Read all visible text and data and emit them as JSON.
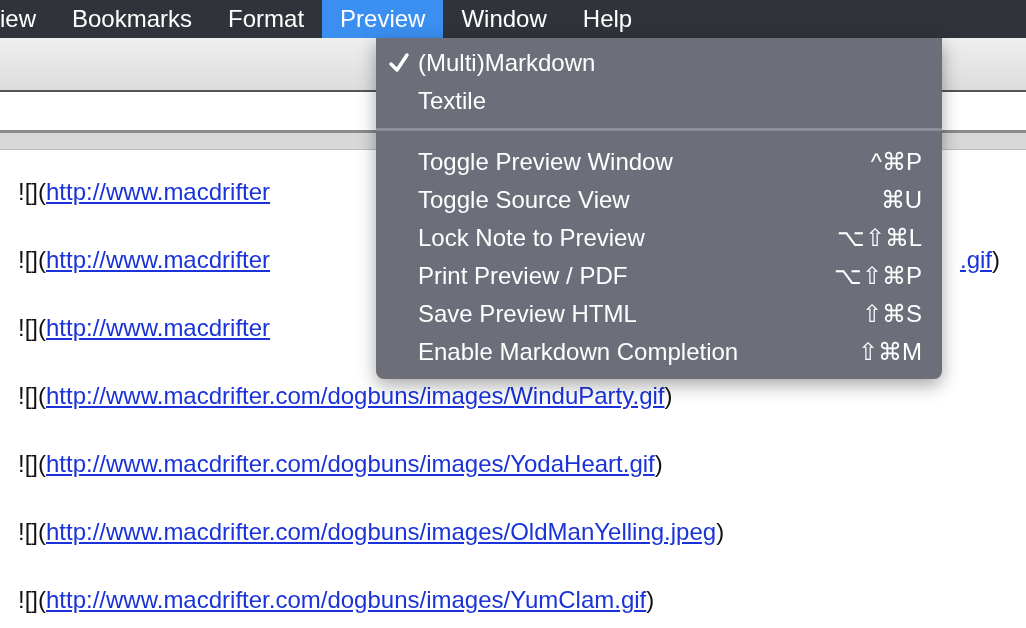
{
  "menubar": [
    {
      "label": "iew",
      "selected": false
    },
    {
      "label": "Bookmarks",
      "selected": false
    },
    {
      "label": "Format",
      "selected": false
    },
    {
      "label": "Preview",
      "selected": true
    },
    {
      "label": "Window",
      "selected": false
    },
    {
      "label": "Help",
      "selected": false
    }
  ],
  "menu": {
    "items": [
      {
        "kind": "option",
        "label": "(Multi)Markdown",
        "checked": true
      },
      {
        "kind": "option",
        "label": "Textile",
        "checked": false
      },
      {
        "kind": "separator"
      },
      {
        "kind": "command",
        "label": "Toggle Preview Window",
        "shortcut": "^⌘P"
      },
      {
        "kind": "command",
        "label": "Toggle Source View",
        "shortcut": "⌘U"
      },
      {
        "kind": "command",
        "label": "Lock Note to Preview",
        "shortcut": "⌥⇧⌘L"
      },
      {
        "kind": "command",
        "label": "Print Preview / PDF",
        "shortcut": "⌥⇧⌘P"
      },
      {
        "kind": "command",
        "label": "Save Preview HTML",
        "shortcut": "⇧⌘S"
      },
      {
        "kind": "command",
        "label": "Enable Markdown Completion",
        "shortcut": "⇧⌘M"
      }
    ]
  },
  "lines": [
    {
      "prefix": "![](",
      "link": "http://www.macdrifter"
    },
    {
      "prefix": "![](",
      "link": "http://www.macdrifter",
      "tail_link": ".gif",
      "tail": ")"
    },
    {
      "prefix": "![](",
      "link": "http://www.macdrifter"
    },
    {
      "prefix": "![](",
      "link": "http://www.macdrifter.com/dogbuns/images/WinduParty.gif",
      "tail": ")"
    },
    {
      "prefix": "![](",
      "link": "http://www.macdrifter.com/dogbuns/images/YodaHeart.gif",
      "tail": ")"
    },
    {
      "prefix": "![](",
      "link": "http://www.macdrifter.com/dogbuns/images/OldManYelling.jpeg",
      "tail": ")"
    },
    {
      "prefix": "![](",
      "link": "http://www.macdrifter.com/dogbuns/images/YumClam.gif",
      "tail": ")"
    }
  ]
}
